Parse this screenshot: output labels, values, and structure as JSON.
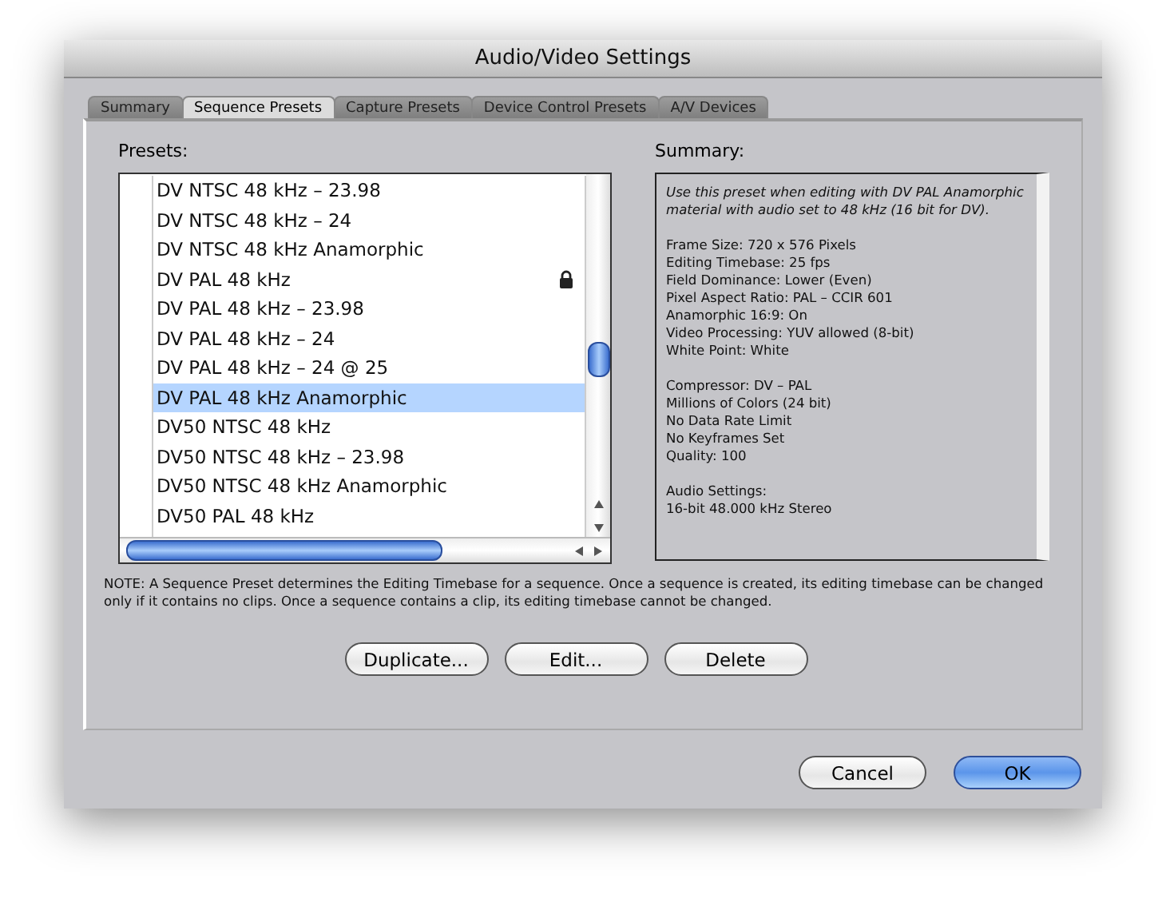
{
  "window": {
    "title": "Audio/Video Settings"
  },
  "tabs": [
    {
      "label": "Summary",
      "selected": false
    },
    {
      "label": "Sequence Presets",
      "selected": true
    },
    {
      "label": "Capture Presets",
      "selected": false
    },
    {
      "label": "Device Control Presets",
      "selected": false
    },
    {
      "label": "A/V Devices",
      "selected": false
    }
  ],
  "presets": {
    "label": "Presets:",
    "items": [
      {
        "name": "DV NTSC 48 kHz – 23.98",
        "selected": false,
        "locked": false
      },
      {
        "name": "DV NTSC 48 kHz – 24",
        "selected": false,
        "locked": false
      },
      {
        "name": "DV NTSC 48 kHz Anamorphic",
        "selected": false,
        "locked": false
      },
      {
        "name": "DV PAL 48 kHz",
        "selected": false,
        "locked": true
      },
      {
        "name": "DV PAL 48 kHz – 23.98",
        "selected": false,
        "locked": false
      },
      {
        "name": "DV PAL 48 kHz – 24",
        "selected": false,
        "locked": false
      },
      {
        "name": "DV PAL 48 kHz – 24 @ 25",
        "selected": false,
        "locked": false
      },
      {
        "name": "DV PAL 48 kHz Anamorphic",
        "selected": true,
        "locked": false
      },
      {
        "name": "DV50 NTSC 48 kHz",
        "selected": false,
        "locked": false
      },
      {
        "name": "DV50 NTSC 48 kHz – 23.98",
        "selected": false,
        "locked": false
      },
      {
        "name": "DV50 NTSC 48 kHz Anamorphic",
        "selected": false,
        "locked": false
      },
      {
        "name": "DV50 PAL 48 kHz",
        "selected": false,
        "locked": false
      }
    ]
  },
  "summary": {
    "label": "Summary:",
    "description": "Use this preset when editing with DV PAL Anamorphic material with audio set to 48 kHz (16 bit for DV).",
    "groups": [
      [
        "Frame Size: 720 x 576 Pixels",
        "Editing Timebase: 25 fps",
        "Field Dominance: Lower (Even)",
        "Pixel Aspect Ratio: PAL – CCIR 601",
        "Anamorphic 16:9: On",
        "Video Processing: YUV allowed (8-bit)",
        "White Point: White"
      ],
      [
        "Compressor: DV – PAL",
        "Millions of Colors (24 bit)",
        "No Data Rate Limit",
        "No Keyframes Set",
        "Quality: 100"
      ],
      [
        "Audio Settings:",
        "16-bit 48.000 kHz Stereo"
      ]
    ]
  },
  "note": "NOTE: A Sequence Preset determines the Editing Timebase for a sequence. Once a sequence is created, its editing timebase can be changed only if it contains no clips. Once a sequence contains a clip, its editing timebase cannot be changed.",
  "actions": [
    "Duplicate...",
    "Edit...",
    "Delete"
  ],
  "buttons": [
    {
      "label": "Cancel",
      "kind": "normal"
    },
    {
      "label": "OK",
      "kind": "default"
    }
  ]
}
